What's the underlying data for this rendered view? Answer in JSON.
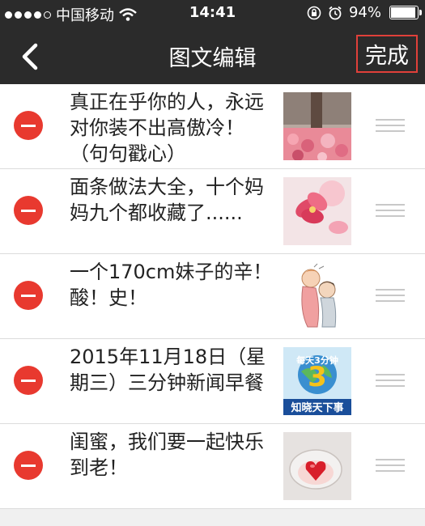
{
  "status_bar": {
    "carrier": "中国移动",
    "time": "14:41",
    "battery_percent": "94%",
    "battery_level": 0.94,
    "icons": [
      "signal-dots-icon",
      "wifi-icon",
      "rotation-lock-icon",
      "alarm-icon",
      "battery-icon"
    ]
  },
  "navbar": {
    "title": "图文编辑",
    "done_label": "完成",
    "back_icon": "chevron-left-icon",
    "done_highlight_color": "#e0403a"
  },
  "list": {
    "items": [
      {
        "title": "真正在乎你的人，永远对你装不出高傲冷！（句句戳心）",
        "thumb": "pink-flowers-tree"
      },
      {
        "title": "面条做法大全，十个妈妈九个都收藏了......",
        "thumb": "pink-blossom"
      },
      {
        "title": "一个170cm妹子的辛！酸！史！",
        "thumb": "cartoon-couple"
      },
      {
        "title": "2015年11月18日（星期三）三分钟新闻早餐",
        "thumb": "news-logo"
      },
      {
        "title": "闺蜜，我们要一起快乐到老！",
        "thumb": "red-heart-glass"
      }
    ],
    "thumb_logo_text": {
      "top": "每天3分钟",
      "bottom": "知晓天下事"
    }
  },
  "colors": {
    "bar_bg": "#2b2b2b",
    "delete_red": "#e8392f",
    "divider": "#dcdcdc"
  }
}
